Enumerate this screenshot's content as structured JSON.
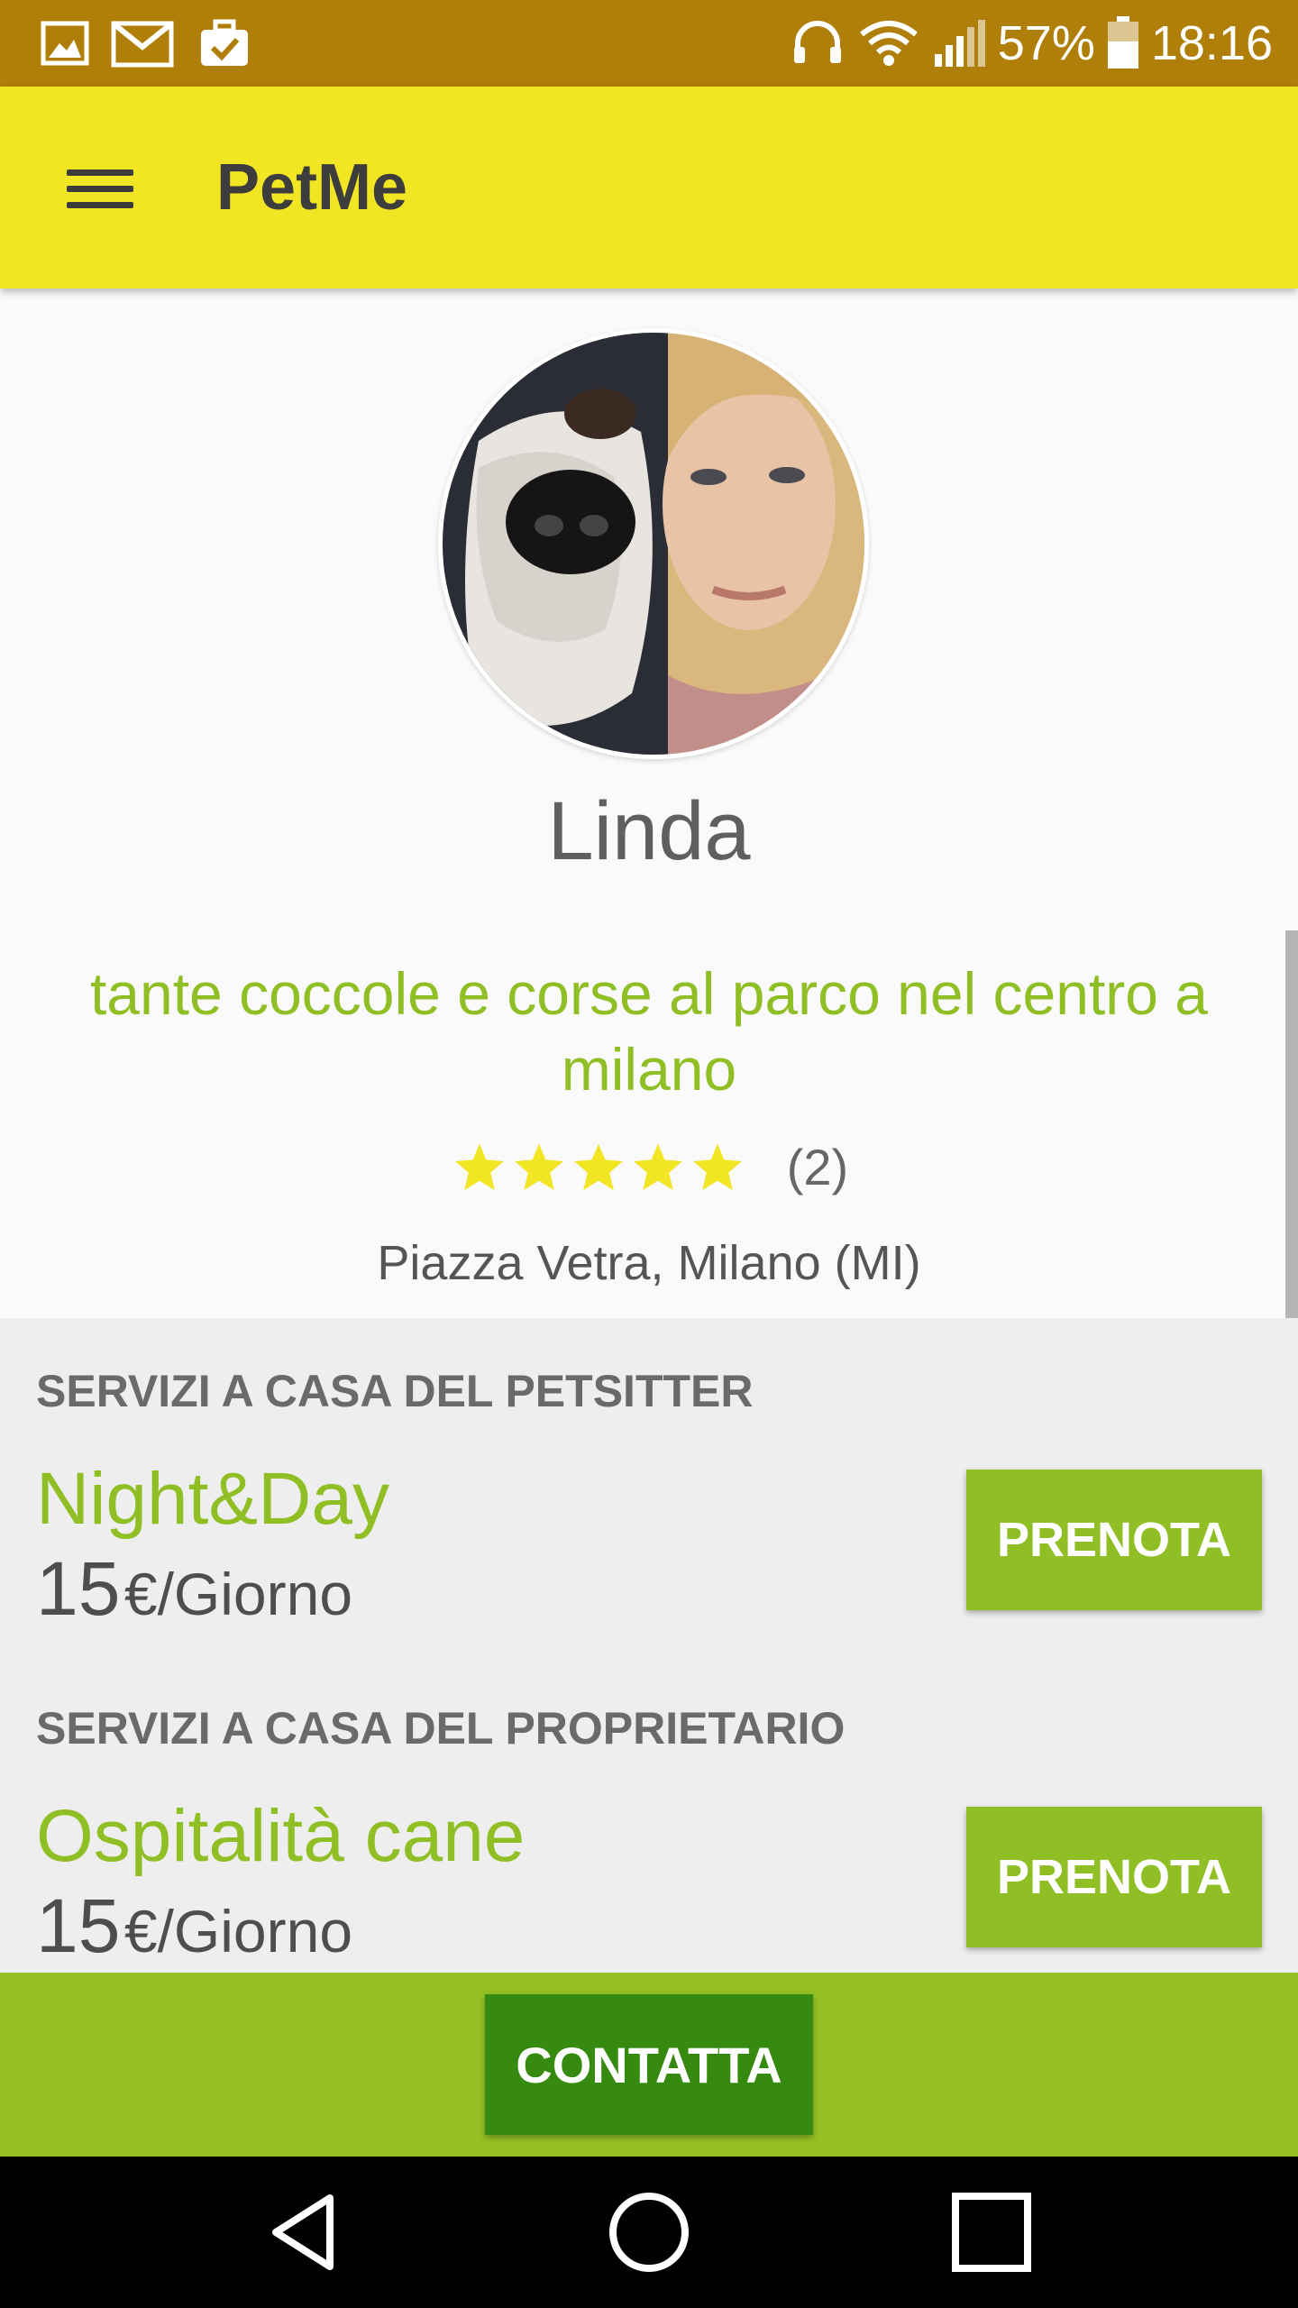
{
  "status_bar": {
    "battery": "57%",
    "time": "18:16",
    "icons": [
      "image-icon",
      "gmail-icon",
      "briefcase-check-icon",
      "headset-icon",
      "wifi-icon",
      "signal-icon",
      "battery-icon"
    ]
  },
  "app_bar": {
    "title": "PetMe",
    "menu_icon": "hamburger-menu-icon",
    "background": "#f2e523"
  },
  "profile": {
    "name": "Linda",
    "bio": "tante coccole e corse al parco nel centro a milano",
    "rating": {
      "stars": 5,
      "max": 5,
      "count": "(2)"
    },
    "address": "Piazza Vetra, Milano (MI)"
  },
  "services": [
    {
      "heading": "SERVIZI A CASA DEL PETSITTER",
      "name": "Night&Day",
      "price": "15",
      "unit": "€/Giorno",
      "button": "PRENOTA"
    },
    {
      "heading": "SERVIZI A CASA DEL PROPRIETARIO",
      "name": "Ospitalità cane",
      "price": "15",
      "unit": "€/Giorno",
      "button": "PRENOTA"
    }
  ],
  "contact_button": "CONTATTA",
  "colors": {
    "status_bar": "#b07f0a",
    "accent_green": "#8fbf24",
    "contact_green": "#368a0f",
    "star_yellow": "#f2e523"
  },
  "nav": [
    "back-icon",
    "home-icon",
    "recents-icon"
  ]
}
